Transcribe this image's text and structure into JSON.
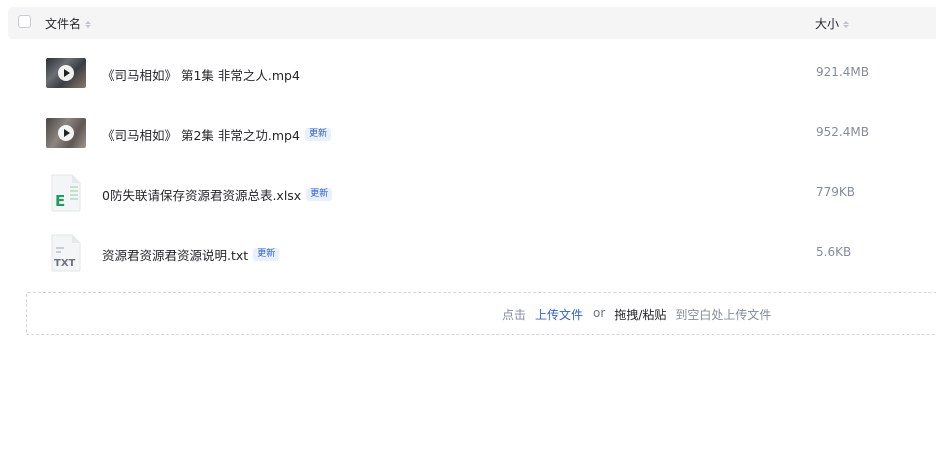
{
  "header": {
    "name_label": "文件名",
    "size_label": "大小"
  },
  "files": [
    {
      "name": "《司马相如》 第1集 非常之人.mp4",
      "size": "921.4MB",
      "type_icon": "video-thumbnail",
      "badge": ""
    },
    {
      "name": "《司马相如》 第2集 非常之功.mp4",
      "size": "952.4MB",
      "type_icon": "video-thumbnail",
      "badge": "更新"
    },
    {
      "name": "0防失联请保存资源君资源总表.xlsx",
      "size": "779KB",
      "type_icon": "excel-file-icon",
      "badge": "更新"
    },
    {
      "name": "资源君资源君资源说明.txt",
      "size": "5.6KB",
      "type_icon": "txt-file-icon",
      "badge": "更新"
    }
  ],
  "upload": {
    "prefix": "点击",
    "link": "上传文件",
    "or": "or",
    "drag": "拖拽/粘贴",
    "suffix": "到空白处上传文件"
  },
  "colors": {
    "accent": "#2f63d8",
    "badge_bg": "#e8effe",
    "header_bg": "#f5f5f6",
    "muted_text": "#878c9c",
    "excel_green": "#1e9e5a"
  }
}
